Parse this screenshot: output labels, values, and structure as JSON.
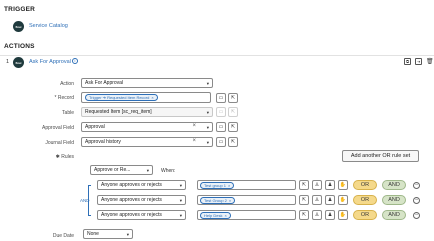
{
  "trigger": {
    "heading": "TRIGGER",
    "logo_text": "flow",
    "name": "Service Catalog"
  },
  "actions": {
    "heading": "ACTIONS",
    "step_number": "1",
    "logo_text": "flow",
    "name": "Ask For Approval",
    "info_icon": "info-icon"
  },
  "form": {
    "action_label": "Action",
    "action_value": "Ask For Approval",
    "record_label": "* Record",
    "record_pill": "Trigger ➔ Requested Item Record",
    "table_label": "Table",
    "table_value": "Requested Item [sc_req_item]",
    "approval_field_label": "Approval Field",
    "approval_field_value": "Approval",
    "journal_field_label": "Journal Field",
    "journal_field_value": "Approval history",
    "rules_label": "✱ Rules",
    "add_rule_set_label": "Add another OR rule set",
    "condition_select": "Approve or Re...",
    "when_label": "When:",
    "and_label": "AND",
    "rules": [
      {
        "mode": "Anyone approves or rejects",
        "group": "Test group 1"
      },
      {
        "mode": "Anyone approves or rejects",
        "group": "Test Group 2"
      },
      {
        "mode": "Anyone approves or rejects",
        "group": "Help Desk"
      }
    ],
    "or_label": "OR",
    "and_btn_label": "AND",
    "due_date_label": "Due Date",
    "due_date_value": "None"
  },
  "colors": {
    "link": "#2e6fb7",
    "or_button": "#f5d98a",
    "and_button": "#d6e4c7",
    "logo": "#1f3a3d"
  }
}
